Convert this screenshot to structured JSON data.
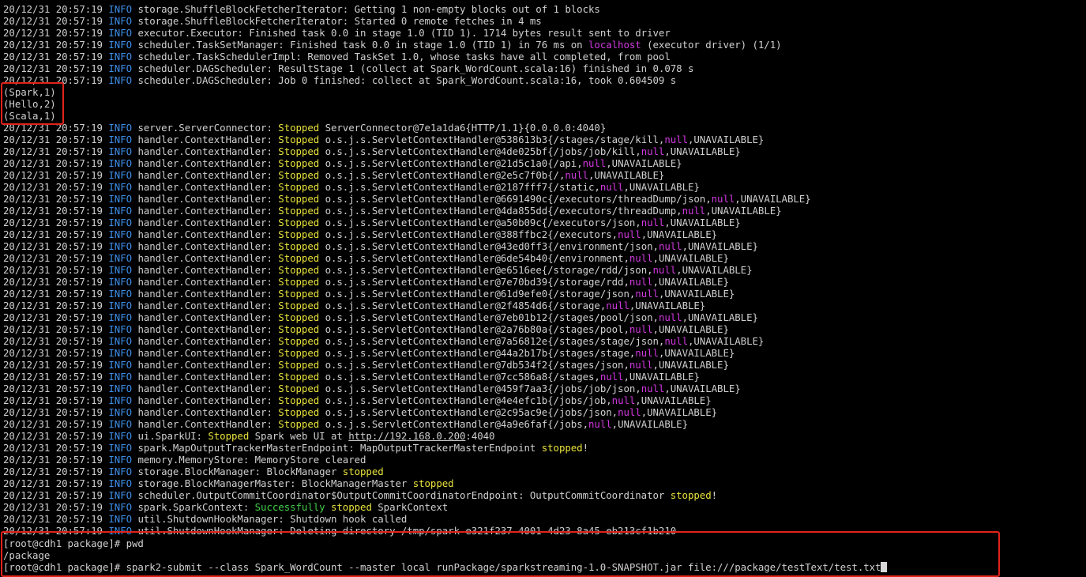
{
  "log": [
    {
      "ts": "20/12/31 20:57:19",
      "level": "INFO",
      "segs": [
        {
          "t": " storage.ShuffleBlockFetcherIterator: Getting 1 non-empty blocks out of 1 blocks",
          "c": ""
        }
      ]
    },
    {
      "ts": "20/12/31 20:57:19",
      "level": "INFO",
      "segs": [
        {
          "t": " storage.ShuffleBlockFetcherIterator: Started 0 remote fetches in 4 ms",
          "c": ""
        }
      ]
    },
    {
      "ts": "20/12/31 20:57:19",
      "level": "INFO",
      "segs": [
        {
          "t": " executor.Executor: Finished task 0.0 in stage 1.0 (TID 1). 1714 bytes result sent to driver",
          "c": ""
        }
      ]
    },
    {
      "ts": "20/12/31 20:57:19",
      "level": "INFO",
      "segs": [
        {
          "t": " scheduler.TaskSetManager: Finished task 0.0 in stage 1.0 (TID 1) in 76 ms on ",
          "c": ""
        },
        {
          "t": "localhost",
          "c": "magenta"
        },
        {
          "t": " (executor driver) (1/1)",
          "c": ""
        }
      ]
    },
    {
      "ts": "20/12/31 20:57:19",
      "level": "INFO",
      "segs": [
        {
          "t": " scheduler.TaskSchedulerImpl: Removed TaskSet 1.0, whose tasks have all completed, from pool",
          "c": ""
        }
      ]
    },
    {
      "ts": "20/12/31 20:57:19",
      "level": "INFO",
      "segs": [
        {
          "t": " scheduler.DAGScheduler: ResultStage 1 (collect at Spark_WordCount.scala:16) finished in 0.078 s",
          "c": ""
        }
      ]
    },
    {
      "ts": "20/12/31 20:57:19",
      "level": "INFO",
      "segs": [
        {
          "t": " scheduler.DAGScheduler: Job 0 finished: collect at Spark_WordCount.scala:16, took 0.604509 s",
          "c": ""
        }
      ]
    },
    {
      "ts": "",
      "level": "",
      "segs": [
        {
          "t": "(Spark,1)",
          "c": ""
        }
      ]
    },
    {
      "ts": "",
      "level": "",
      "segs": [
        {
          "t": "(Hello,2)",
          "c": ""
        }
      ]
    },
    {
      "ts": "",
      "level": "",
      "segs": [
        {
          "t": "(Scala,1)",
          "c": ""
        }
      ]
    },
    {
      "ts": "20/12/31 20:57:19",
      "level": "INFO",
      "segs": [
        {
          "t": " server.ServerConnector: ",
          "c": ""
        },
        {
          "t": "Stopped",
          "c": "yellow"
        },
        {
          "t": " ServerConnector@7e1a1da6{HTTP/1.1}{0.0.0.0:4040}",
          "c": ""
        }
      ]
    },
    {
      "ts": "20/12/31 20:57:19",
      "level": "INFO",
      "segs": [
        {
          "t": " handler.ContextHandler: ",
          "c": ""
        },
        {
          "t": "Stopped",
          "c": "yellow"
        },
        {
          "t": " o.s.j.s.ServletContextHandler@538613b3{/stages/stage/kill,",
          "c": ""
        },
        {
          "t": "null",
          "c": "magenta"
        },
        {
          "t": ",UNAVAILABLE}",
          "c": ""
        }
      ]
    },
    {
      "ts": "20/12/31 20:57:19",
      "level": "INFO",
      "segs": [
        {
          "t": " handler.ContextHandler: ",
          "c": ""
        },
        {
          "t": "Stopped",
          "c": "yellow"
        },
        {
          "t": " o.s.j.s.ServletContextHandler@4de025bf{/jobs/job/kill,",
          "c": ""
        },
        {
          "t": "null",
          "c": "magenta"
        },
        {
          "t": ",UNAVAILABLE}",
          "c": ""
        }
      ]
    },
    {
      "ts": "20/12/31 20:57:19",
      "level": "INFO",
      "segs": [
        {
          "t": " handler.ContextHandler: ",
          "c": ""
        },
        {
          "t": "Stopped",
          "c": "yellow"
        },
        {
          "t": " o.s.j.s.ServletContextHandler@21d5c1a0{/api,",
          "c": ""
        },
        {
          "t": "null",
          "c": "magenta"
        },
        {
          "t": ",UNAVAILABLE}",
          "c": ""
        }
      ]
    },
    {
      "ts": "20/12/31 20:57:19",
      "level": "INFO",
      "segs": [
        {
          "t": " handler.ContextHandler: ",
          "c": ""
        },
        {
          "t": "Stopped",
          "c": "yellow"
        },
        {
          "t": " o.s.j.s.ServletContextHandler@2e5c7f0b{/,",
          "c": ""
        },
        {
          "t": "null",
          "c": "magenta"
        },
        {
          "t": ",UNAVAILABLE}",
          "c": ""
        }
      ]
    },
    {
      "ts": "20/12/31 20:57:19",
      "level": "INFO",
      "segs": [
        {
          "t": " handler.ContextHandler: ",
          "c": ""
        },
        {
          "t": "Stopped",
          "c": "yellow"
        },
        {
          "t": " o.s.j.s.ServletContextHandler@2187fff7{/static,",
          "c": ""
        },
        {
          "t": "null",
          "c": "magenta"
        },
        {
          "t": ",UNAVAILABLE}",
          "c": ""
        }
      ]
    },
    {
      "ts": "20/12/31 20:57:19",
      "level": "INFO",
      "segs": [
        {
          "t": " handler.ContextHandler: ",
          "c": ""
        },
        {
          "t": "Stopped",
          "c": "yellow"
        },
        {
          "t": " o.s.j.s.ServletContextHandler@6691490c{/executors/threadDump/json,",
          "c": ""
        },
        {
          "t": "null",
          "c": "magenta"
        },
        {
          "t": ",UNAVAILABLE}",
          "c": ""
        }
      ]
    },
    {
      "ts": "20/12/31 20:57:19",
      "level": "INFO",
      "segs": [
        {
          "t": " handler.ContextHandler: ",
          "c": ""
        },
        {
          "t": "Stopped",
          "c": "yellow"
        },
        {
          "t": " o.s.j.s.ServletContextHandler@4da855dd{/executors/threadDump,",
          "c": ""
        },
        {
          "t": "null",
          "c": "magenta"
        },
        {
          "t": ",UNAVAILABLE}",
          "c": ""
        }
      ]
    },
    {
      "ts": "20/12/31 20:57:19",
      "level": "INFO",
      "segs": [
        {
          "t": " handler.ContextHandler: ",
          "c": ""
        },
        {
          "t": "Stopped",
          "c": "yellow"
        },
        {
          "t": " o.s.j.s.ServletContextHandler@a50b09c{/executors/json,",
          "c": ""
        },
        {
          "t": "null",
          "c": "magenta"
        },
        {
          "t": ",UNAVAILABLE}",
          "c": ""
        }
      ]
    },
    {
      "ts": "20/12/31 20:57:19",
      "level": "INFO",
      "segs": [
        {
          "t": " handler.ContextHandler: ",
          "c": ""
        },
        {
          "t": "Stopped",
          "c": "yellow"
        },
        {
          "t": " o.s.j.s.ServletContextHandler@388ffbc2{/executors,",
          "c": ""
        },
        {
          "t": "null",
          "c": "magenta"
        },
        {
          "t": ",UNAVAILABLE}",
          "c": ""
        }
      ]
    },
    {
      "ts": "20/12/31 20:57:19",
      "level": "INFO",
      "segs": [
        {
          "t": " handler.ContextHandler: ",
          "c": ""
        },
        {
          "t": "Stopped",
          "c": "yellow"
        },
        {
          "t": " o.s.j.s.ServletContextHandler@43ed0ff3{/environment/json,",
          "c": ""
        },
        {
          "t": "null",
          "c": "magenta"
        },
        {
          "t": ",UNAVAILABLE}",
          "c": ""
        }
      ]
    },
    {
      "ts": "20/12/31 20:57:19",
      "level": "INFO",
      "segs": [
        {
          "t": " handler.ContextHandler: ",
          "c": ""
        },
        {
          "t": "Stopped",
          "c": "yellow"
        },
        {
          "t": " o.s.j.s.ServletContextHandler@6de54b40{/environment,",
          "c": ""
        },
        {
          "t": "null",
          "c": "magenta"
        },
        {
          "t": ",UNAVAILABLE}",
          "c": ""
        }
      ]
    },
    {
      "ts": "20/12/31 20:57:19",
      "level": "INFO",
      "segs": [
        {
          "t": " handler.ContextHandler: ",
          "c": ""
        },
        {
          "t": "Stopped",
          "c": "yellow"
        },
        {
          "t": " o.s.j.s.ServletContextHandler@e6516ee{/storage/rdd/json,",
          "c": ""
        },
        {
          "t": "null",
          "c": "magenta"
        },
        {
          "t": ",UNAVAILABLE}",
          "c": ""
        }
      ]
    },
    {
      "ts": "20/12/31 20:57:19",
      "level": "INFO",
      "segs": [
        {
          "t": " handler.ContextHandler: ",
          "c": ""
        },
        {
          "t": "Stopped",
          "c": "yellow"
        },
        {
          "t": " o.s.j.s.ServletContextHandler@7e70bd39{/storage/rdd,",
          "c": ""
        },
        {
          "t": "null",
          "c": "magenta"
        },
        {
          "t": ",UNAVAILABLE}",
          "c": ""
        }
      ]
    },
    {
      "ts": "20/12/31 20:57:19",
      "level": "INFO",
      "segs": [
        {
          "t": " handler.ContextHandler: ",
          "c": ""
        },
        {
          "t": "Stopped",
          "c": "yellow"
        },
        {
          "t": " o.s.j.s.ServletContextHandler@61d9efe0{/storage/json,",
          "c": ""
        },
        {
          "t": "null",
          "c": "magenta"
        },
        {
          "t": ",UNAVAILABLE}",
          "c": ""
        }
      ]
    },
    {
      "ts": "20/12/31 20:57:19",
      "level": "INFO",
      "segs": [
        {
          "t": " handler.ContextHandler: ",
          "c": ""
        },
        {
          "t": "Stopped",
          "c": "yellow"
        },
        {
          "t": " o.s.j.s.ServletContextHandler@2f4854d6{/storage,",
          "c": ""
        },
        {
          "t": "null",
          "c": "magenta"
        },
        {
          "t": ",UNAVAILABLE}",
          "c": ""
        }
      ]
    },
    {
      "ts": "20/12/31 20:57:19",
      "level": "INFO",
      "segs": [
        {
          "t": " handler.ContextHandler: ",
          "c": ""
        },
        {
          "t": "Stopped",
          "c": "yellow"
        },
        {
          "t": " o.s.j.s.ServletContextHandler@7eb01b12{/stages/pool/json,",
          "c": ""
        },
        {
          "t": "null",
          "c": "magenta"
        },
        {
          "t": ",UNAVAILABLE}",
          "c": ""
        }
      ]
    },
    {
      "ts": "20/12/31 20:57:19",
      "level": "INFO",
      "segs": [
        {
          "t": " handler.ContextHandler: ",
          "c": ""
        },
        {
          "t": "Stopped",
          "c": "yellow"
        },
        {
          "t": " o.s.j.s.ServletContextHandler@2a76b80a{/stages/pool,",
          "c": ""
        },
        {
          "t": "null",
          "c": "magenta"
        },
        {
          "t": ",UNAVAILABLE}",
          "c": ""
        }
      ]
    },
    {
      "ts": "20/12/31 20:57:19",
      "level": "INFO",
      "segs": [
        {
          "t": " handler.ContextHandler: ",
          "c": ""
        },
        {
          "t": "Stopped",
          "c": "yellow"
        },
        {
          "t": " o.s.j.s.ServletContextHandler@7a56812e{/stages/stage/json,",
          "c": ""
        },
        {
          "t": "null",
          "c": "magenta"
        },
        {
          "t": ",UNAVAILABLE}",
          "c": ""
        }
      ]
    },
    {
      "ts": "20/12/31 20:57:19",
      "level": "INFO",
      "segs": [
        {
          "t": " handler.ContextHandler: ",
          "c": ""
        },
        {
          "t": "Stopped",
          "c": "yellow"
        },
        {
          "t": " o.s.j.s.ServletContextHandler@44a2b17b{/stages/stage,",
          "c": ""
        },
        {
          "t": "null",
          "c": "magenta"
        },
        {
          "t": ",UNAVAILABLE}",
          "c": ""
        }
      ]
    },
    {
      "ts": "20/12/31 20:57:19",
      "level": "INFO",
      "segs": [
        {
          "t": " handler.ContextHandler: ",
          "c": ""
        },
        {
          "t": "Stopped",
          "c": "yellow"
        },
        {
          "t": " o.s.j.s.ServletContextHandler@7db534f2{/stages/json,",
          "c": ""
        },
        {
          "t": "null",
          "c": "magenta"
        },
        {
          "t": ",UNAVAILABLE}",
          "c": ""
        }
      ]
    },
    {
      "ts": "20/12/31 20:57:19",
      "level": "INFO",
      "segs": [
        {
          "t": " handler.ContextHandler: ",
          "c": ""
        },
        {
          "t": "Stopped",
          "c": "yellow"
        },
        {
          "t": " o.s.j.s.ServletContextHandler@7cc586a8{/stages,",
          "c": ""
        },
        {
          "t": "null",
          "c": "magenta"
        },
        {
          "t": ",UNAVAILABLE}",
          "c": ""
        }
      ]
    },
    {
      "ts": "20/12/31 20:57:19",
      "level": "INFO",
      "segs": [
        {
          "t": " handler.ContextHandler: ",
          "c": ""
        },
        {
          "t": "Stopped",
          "c": "yellow"
        },
        {
          "t": " o.s.j.s.ServletContextHandler@459f7aa3{/jobs/job/json,",
          "c": ""
        },
        {
          "t": "null",
          "c": "magenta"
        },
        {
          "t": ",UNAVAILABLE}",
          "c": ""
        }
      ]
    },
    {
      "ts": "20/12/31 20:57:19",
      "level": "INFO",
      "segs": [
        {
          "t": " handler.ContextHandler: ",
          "c": ""
        },
        {
          "t": "Stopped",
          "c": "yellow"
        },
        {
          "t": " o.s.j.s.ServletContextHandler@4e4efc1b{/jobs/job,",
          "c": ""
        },
        {
          "t": "null",
          "c": "magenta"
        },
        {
          "t": ",UNAVAILABLE}",
          "c": ""
        }
      ]
    },
    {
      "ts": "20/12/31 20:57:19",
      "level": "INFO",
      "segs": [
        {
          "t": " handler.ContextHandler: ",
          "c": ""
        },
        {
          "t": "Stopped",
          "c": "yellow"
        },
        {
          "t": " o.s.j.s.ServletContextHandler@2c95ac9e{/jobs/json,",
          "c": ""
        },
        {
          "t": "null",
          "c": "magenta"
        },
        {
          "t": ",UNAVAILABLE}",
          "c": ""
        }
      ]
    },
    {
      "ts": "20/12/31 20:57:19",
      "level": "INFO",
      "segs": [
        {
          "t": " handler.ContextHandler: ",
          "c": ""
        },
        {
          "t": "Stopped",
          "c": "yellow"
        },
        {
          "t": " o.s.j.s.ServletContextHandler@4a9e6faf{/jobs,",
          "c": ""
        },
        {
          "t": "null",
          "c": "magenta"
        },
        {
          "t": ",UNAVAILABLE}",
          "c": ""
        }
      ]
    },
    {
      "ts": "20/12/31 20:57:19",
      "level": "INFO",
      "segs": [
        {
          "t": " ui.SparkUI: ",
          "c": ""
        },
        {
          "t": "Stopped",
          "c": "yellow"
        },
        {
          "t": " Spark web UI at ",
          "c": ""
        },
        {
          "t": "http://192.168.0.200",
          "c": "url"
        },
        {
          "t": ":4040",
          "c": ""
        }
      ]
    },
    {
      "ts": "20/12/31 20:57:19",
      "level": "INFO",
      "segs": [
        {
          "t": " spark.MapOutputTrackerMasterEndpoint: MapOutputTrackerMasterEndpoint ",
          "c": ""
        },
        {
          "t": "stopped",
          "c": "yellow"
        },
        {
          "t": "!",
          "c": ""
        }
      ]
    },
    {
      "ts": "20/12/31 20:57:19",
      "level": "INFO",
      "segs": [
        {
          "t": " memory.MemoryStore: MemoryStore cleared",
          "c": ""
        }
      ]
    },
    {
      "ts": "20/12/31 20:57:19",
      "level": "INFO",
      "segs": [
        {
          "t": " storage.BlockManager: BlockManager ",
          "c": ""
        },
        {
          "t": "stopped",
          "c": "yellow"
        }
      ]
    },
    {
      "ts": "20/12/31 20:57:19",
      "level": "INFO",
      "segs": [
        {
          "t": " storage.BlockManagerMaster: BlockManagerMaster ",
          "c": ""
        },
        {
          "t": "stopped",
          "c": "yellow"
        }
      ]
    },
    {
      "ts": "20/12/31 20:57:19",
      "level": "INFO",
      "segs": [
        {
          "t": " scheduler.OutputCommitCoordinator$OutputCommitCoordinatorEndpoint: OutputCommitCoordinator ",
          "c": ""
        },
        {
          "t": "stopped",
          "c": "yellow"
        },
        {
          "t": "!",
          "c": ""
        }
      ]
    },
    {
      "ts": "20/12/31 20:57:19",
      "level": "INFO",
      "segs": [
        {
          "t": " spark.SparkContext: ",
          "c": ""
        },
        {
          "t": "Successfully",
          "c": "green"
        },
        {
          "t": " ",
          "c": ""
        },
        {
          "t": "stopped",
          "c": "yellow"
        },
        {
          "t": " SparkContext",
          "c": ""
        }
      ]
    },
    {
      "ts": "20/12/31 20:57:19",
      "level": "INFO",
      "segs": [
        {
          "t": " util.ShutdownHookManager: Shutdown hook called",
          "c": ""
        }
      ]
    },
    {
      "ts": "20/12/31 20:57:19",
      "level": "INFO",
      "segs": [
        {
          "t": " util.ShutdownHookManager: Deleting directory /tmp/spark-e321f237-4001-4d23-8a45-eb213cf1b210",
          "c": ""
        }
      ]
    },
    {
      "ts": "",
      "level": "",
      "segs": [
        {
          "t": "[root@cdh1 package]# pwd",
          "c": ""
        }
      ]
    },
    {
      "ts": "",
      "level": "",
      "segs": [
        {
          "t": "/package",
          "c": ""
        }
      ]
    },
    {
      "ts": "",
      "level": "",
      "segs": [
        {
          "t": "[root@cdh1 package]# spark2-submit --class Spark_WordCount --master local runPackage/sparkstreaming-1.0-SNAPSHOT.jar file:///package/testText/test.txt",
          "c": ""
        }
      ]
    }
  ],
  "colors": {
    "background": "#000000",
    "text": "#d0d0d0",
    "info": "#3d8ee8",
    "stopped": "#e8e23c",
    "null": "#d238e0",
    "success": "#44d04a",
    "highlight_box": "#e2231a"
  }
}
